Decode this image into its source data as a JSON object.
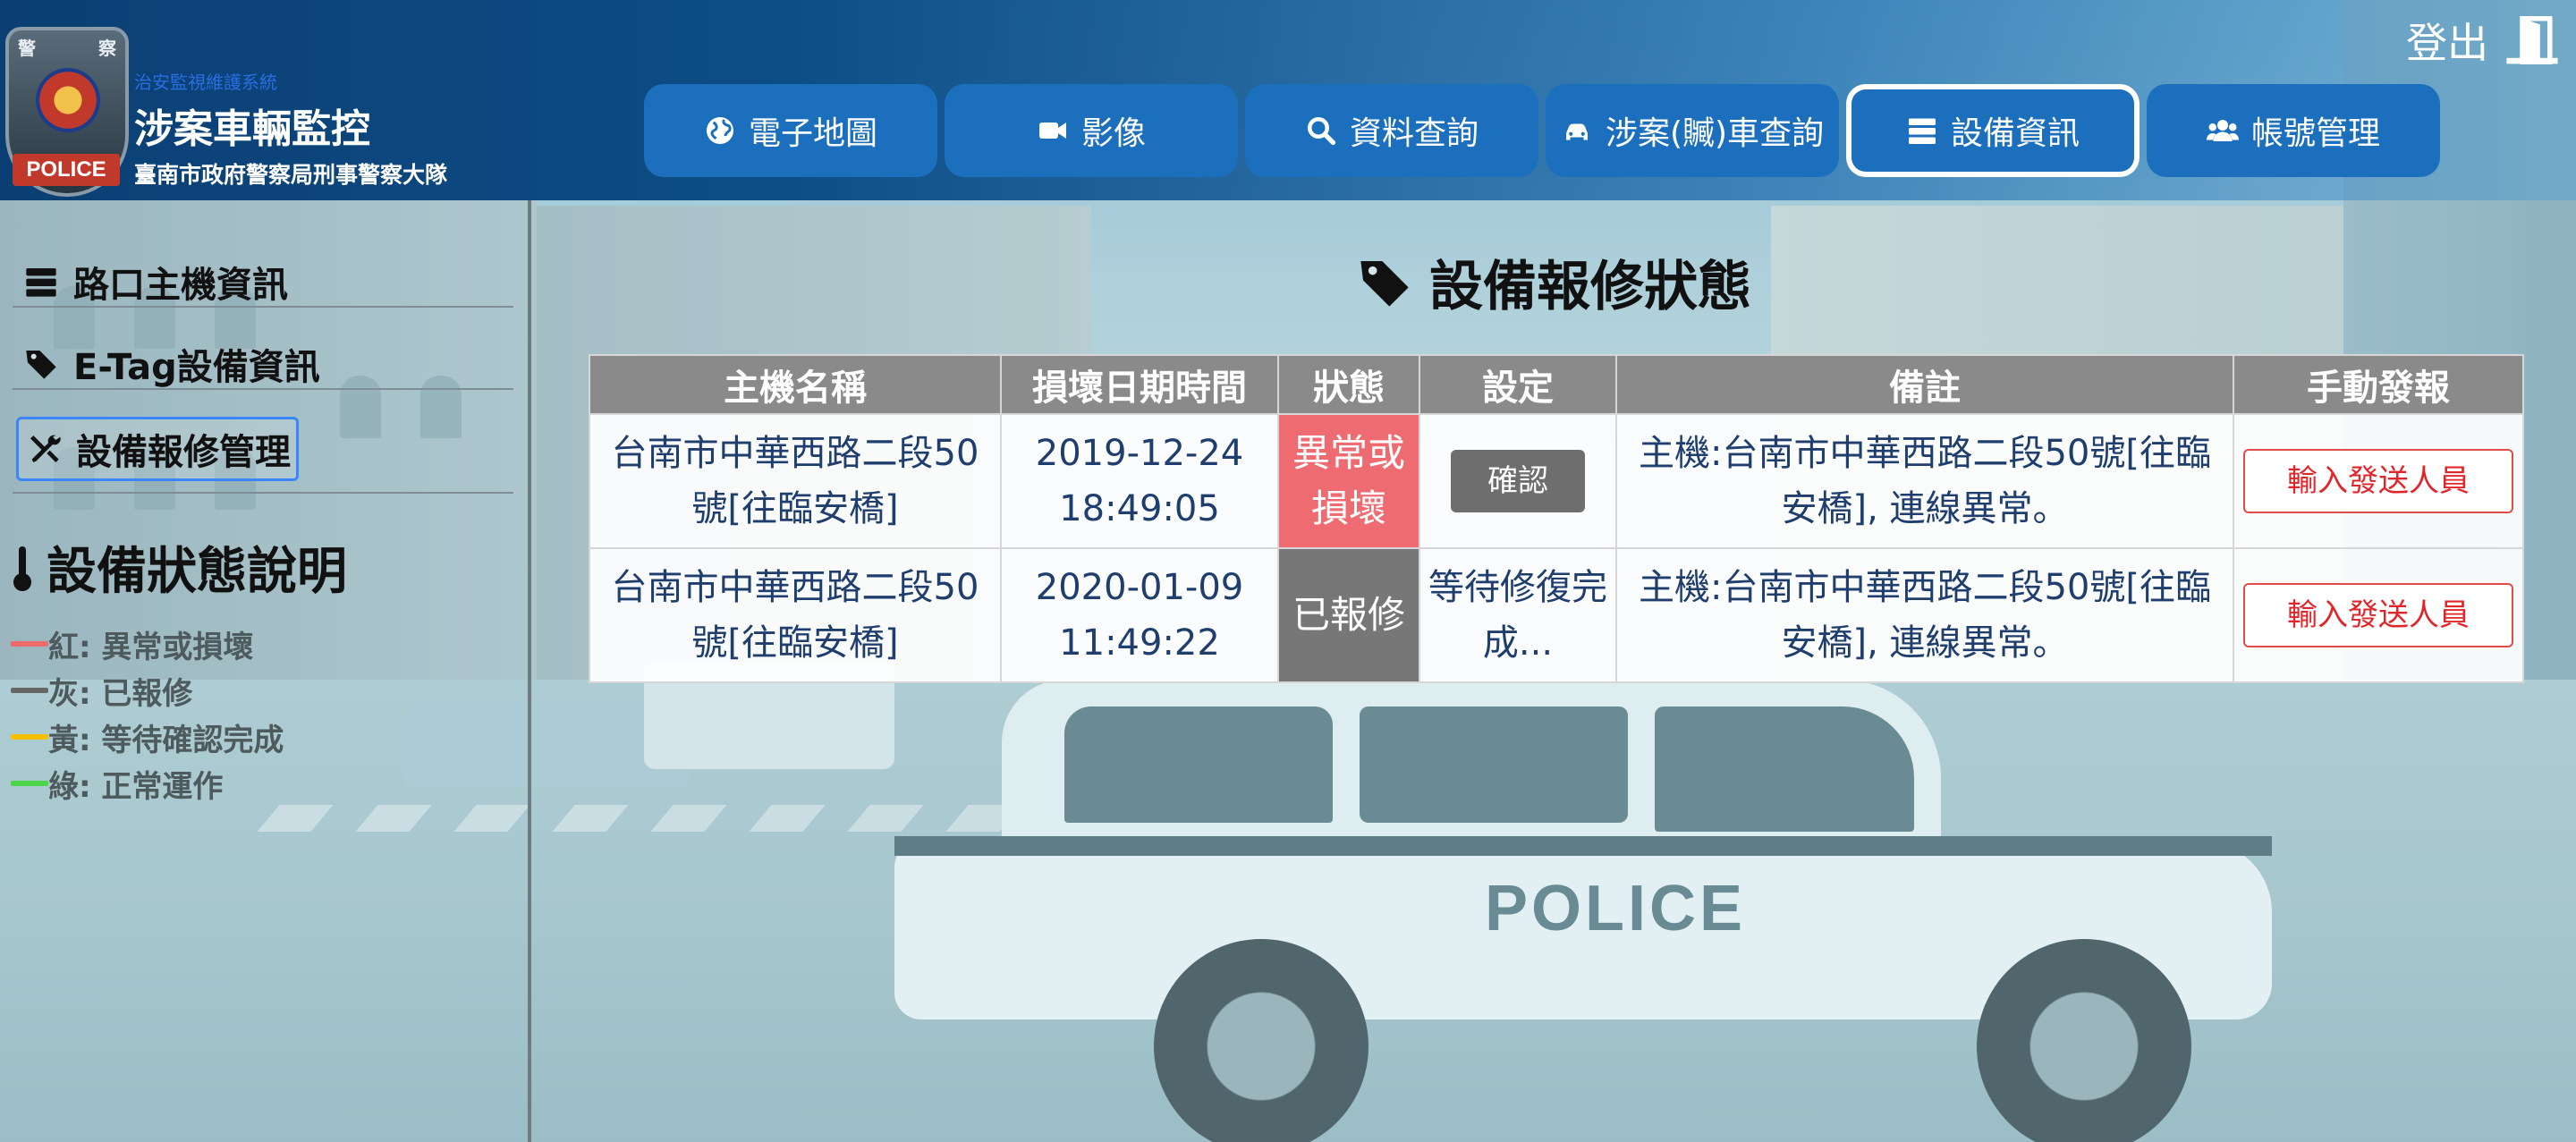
{
  "header": {
    "badge_chars": [
      "警",
      "察"
    ],
    "badge_text": "POLICE",
    "system_small": "治安監視維護系統",
    "title": "涉案車輛監控",
    "subtitle": "臺南市政府警察局刑事警察大隊",
    "logout_label": "登出"
  },
  "nav": [
    {
      "label": "電子地圖",
      "icon": "globe-icon"
    },
    {
      "label": "影像",
      "icon": "video-icon"
    },
    {
      "label": "資料查詢",
      "icon": "search-icon"
    },
    {
      "label": "涉案(贓)車查詢",
      "icon": "car-icon"
    },
    {
      "label": "設備資訊",
      "icon": "server-icon",
      "active": true
    },
    {
      "label": "帳號管理",
      "icon": "users-icon"
    }
  ],
  "sidebar": {
    "items": [
      {
        "label": "路口主機資訊",
        "icon": "server-icon"
      },
      {
        "label": "E-Tag設備資訊",
        "icon": "tag-icon"
      },
      {
        "label": "設備報修管理",
        "icon": "tools-icon",
        "active": true
      }
    ],
    "legend_title": "設備狀態說明",
    "legend": [
      {
        "label": "紅: 異常或損壞",
        "color": "#f06a6a"
      },
      {
        "label": "灰: 已報修",
        "color": "#666666"
      },
      {
        "label": "黃: 等待確認完成",
        "color": "#f2c200"
      },
      {
        "label": "綠: 正常運作",
        "color": "#4cd64c"
      }
    ]
  },
  "main": {
    "title": "設備報修狀態",
    "columns": [
      "主機名稱",
      "損壞日期時間",
      "狀態",
      "設定",
      "備註",
      "手動發報"
    ],
    "rows": [
      {
        "host": "台南市中華西路二段50號[往臨安橋]",
        "datetime": "2019-12-24 18:49:05",
        "status": "異常或損壞",
        "setting": "確認",
        "note": "主機:台南市中華西路二段50號[往臨安橋], 連線異常。",
        "action": "輸入發送人員"
      },
      {
        "host": "台南市中華西路二段50號[往臨安橋]",
        "datetime": "2020-01-09 11:49:22",
        "status": "已報修",
        "setting": "等待修復完成...",
        "note": "主機:台南市中華西路二段50號[往臨安橋], 連線異常。",
        "action": "輸入發送人員"
      }
    ]
  }
}
